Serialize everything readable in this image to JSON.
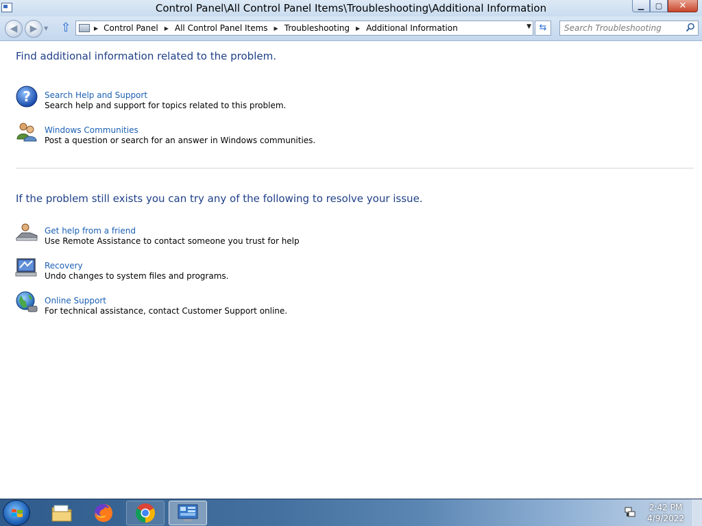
{
  "window": {
    "title": "Control Panel\\All Control Panel Items\\Troubleshooting\\Additional Information",
    "controls": {
      "minimize": "▁",
      "maximize": "▢",
      "close": "✕"
    }
  },
  "navbar": {
    "breadcrumbs": [
      "Control Panel",
      "All Control Panel Items",
      "Troubleshooting",
      "Additional Information"
    ],
    "search_placeholder": "Search Troubleshooting"
  },
  "section1": {
    "heading": "Find additional information related to the problem.",
    "items": [
      {
        "title": "Search Help and Support",
        "description": "Search help and support for topics related to this problem.",
        "icon": "help-question-icon"
      },
      {
        "title": "Windows Communities",
        "description": "Post a question or search for an answer in Windows communities.",
        "icon": "people-icon"
      }
    ]
  },
  "section2": {
    "heading": "If the problem still exists you can try any of the following to resolve your issue.",
    "items": [
      {
        "title": "Get help from a friend",
        "description": "Use Remote Assistance to contact someone you trust for help",
        "icon": "remote-assistance-icon"
      },
      {
        "title": "Recovery",
        "description": "Undo changes to system files and programs.",
        "icon": "recovery-icon"
      },
      {
        "title": "Online Support",
        "description": "For technical assistance, contact Customer Support online.",
        "icon": "globe-icon"
      }
    ]
  },
  "taskbar": {
    "items": [
      "windows-explorer",
      "firefox",
      "chrome",
      "control-panel"
    ],
    "clock": {
      "time": "2:42 PM",
      "date": "4/9/2022"
    }
  },
  "colors": {
    "heading": "#1e3f87",
    "link": "#1a5fb4",
    "titlebar": "#c9dcef",
    "taskbar": "#2f5b8c"
  }
}
